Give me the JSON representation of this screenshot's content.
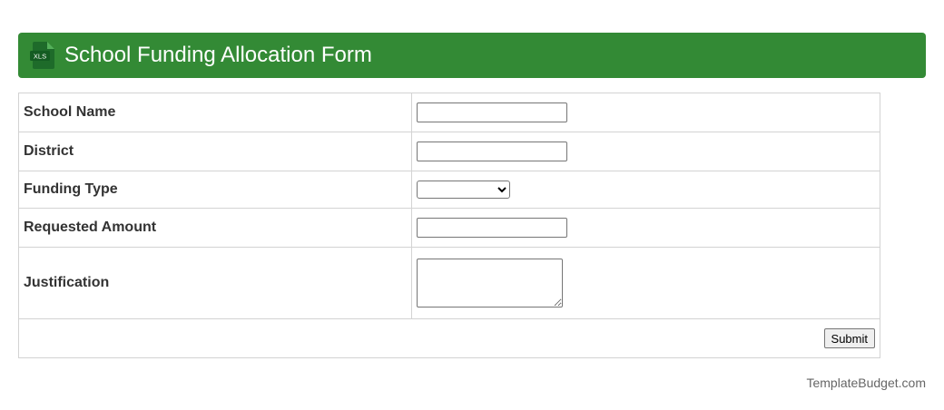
{
  "header": {
    "title": "School Funding Allocation Form",
    "icon": "xls-file-icon",
    "icon_text": "XLS",
    "background_color": "#338a35"
  },
  "form": {
    "fields": [
      {
        "label": "School Name",
        "type": "text",
        "value": ""
      },
      {
        "label": "District",
        "type": "text",
        "value": ""
      },
      {
        "label": "Funding Type",
        "type": "select",
        "value": ""
      },
      {
        "label": "Requested Amount",
        "type": "text",
        "value": ""
      },
      {
        "label": "Justification",
        "type": "textarea",
        "value": ""
      }
    ],
    "submit_label": "Submit"
  },
  "footer": {
    "text": "TemplateBudget.com"
  }
}
